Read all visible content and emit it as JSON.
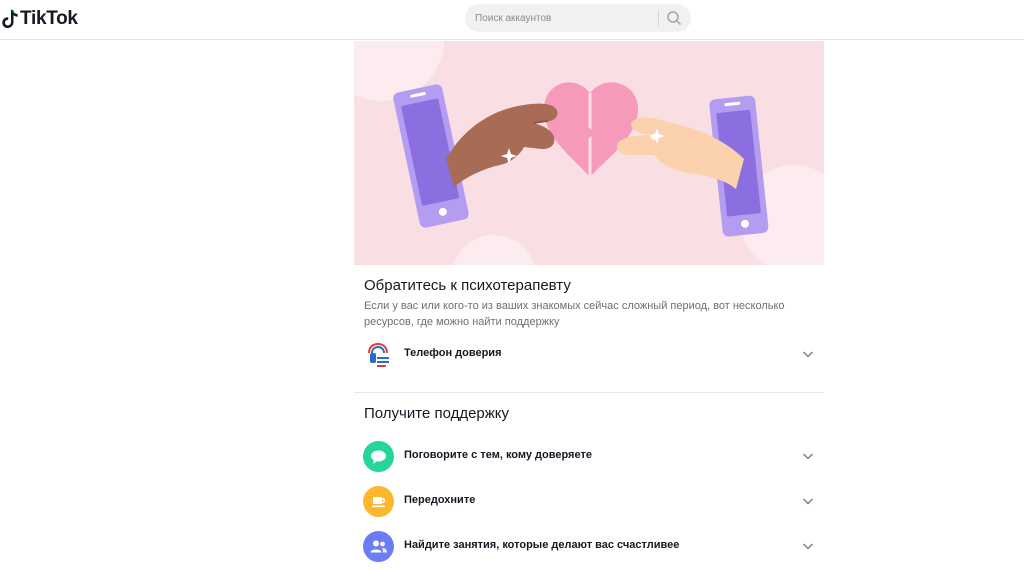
{
  "header": {
    "logo_text": "TikTok",
    "search_placeholder": "Поиск аккаунтов",
    "search_icon": "search-icon"
  },
  "colors": {
    "banner_bg": "#f9dfe4",
    "heart": "#f59aba",
    "phone": "#b49cf0",
    "talk_icon_bg": "#25d59a",
    "rest_icon_bg": "#fdb72c",
    "activities_icon_bg": "#6b7cf5"
  },
  "therapist": {
    "title": "Обратитесь к психотерапевту",
    "intro_line1": "Если у вас или кого-то из ваших знакомых сейчас сложный период, вот несколько",
    "intro_line2": "ресурсов, где можно найти поддержку",
    "hotline": {
      "label": "Телефон доверия",
      "icon": "hotline-logo-icon"
    }
  },
  "support": {
    "title": "Получите поддержку",
    "items": [
      {
        "label": "Поговорите с тем, кому доверяете",
        "icon": "chat-bubble-icon"
      },
      {
        "label": "Передохните",
        "icon": "coffee-cup-icon"
      },
      {
        "label": "Найдите занятия, которые делают вас счастливее",
        "icon": "people-icon"
      }
    ]
  }
}
